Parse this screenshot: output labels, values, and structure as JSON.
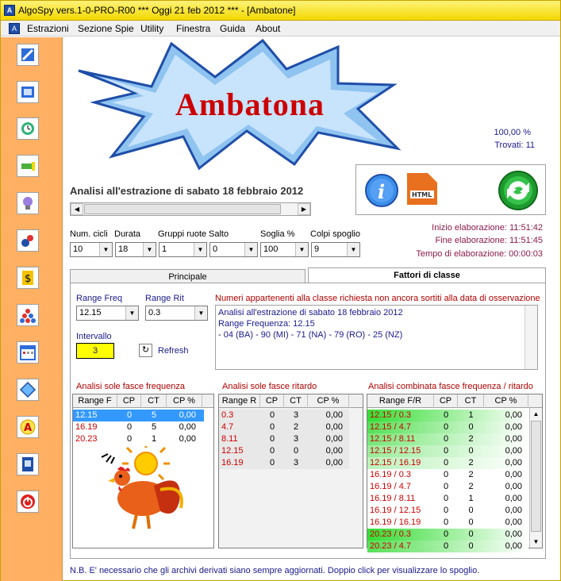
{
  "window": {
    "title": "AlgoSpy vers.1-0-PRO-R00  ***  Oggi 21 feb 2012  ***  - [Ambatone]"
  },
  "menu": [
    "Estrazioni",
    "Sezione Spie",
    "Utility",
    "Finestra",
    "Guida",
    "About"
  ],
  "toolbar_icons": [
    "pencil-icon",
    "book-icon",
    "clock-icon",
    "flashlight-icon",
    "lightbulb-icon",
    "lottery-balls-icon",
    "dollar-icon",
    "pyramid-icon",
    "calendar-icon",
    "diamond-icon",
    "letter-a-icon",
    "notebook-icon",
    "power-icon"
  ],
  "banner": {
    "text": "Ambatona"
  },
  "stats": {
    "percent": "100,00 %",
    "found": "Trovati: 11"
  },
  "analysis_title": "Analisi all'estrazione di sabato 18 febbraio 2012",
  "times": {
    "start": "Inizio elaborazione: 11:51:42",
    "end": "Fine elaborazione: 11:51:45",
    "elapsed": "Tempo di elaborazione: 00:00:03"
  },
  "params": [
    {
      "label": "Num. cicli",
      "value": "10"
    },
    {
      "label": "Durata",
      "value": "18"
    },
    {
      "label": "Gruppi ruote",
      "value": "1"
    },
    {
      "label": "Salto",
      "value": "0"
    },
    {
      "label": "Soglia %",
      "value": "100"
    },
    {
      "label": "Colpi spoglio",
      "value": "9"
    }
  ],
  "tabs": {
    "principale": "Principale",
    "fattori": "Fattori di classe"
  },
  "range_freq": {
    "label": "Range Freq",
    "value": "12.15"
  },
  "range_rit": {
    "label": "Range Rit",
    "value": "0.3"
  },
  "intervallo": {
    "label": "Intervallo",
    "value": "3"
  },
  "refresh_label": "Refresh",
  "numbers_heading": "Numeri appartenenti alla classe richiesta non ancora sortiti alla data di osservazione",
  "numbers_lines": [
    "Analisi all'estrazione di sabato 18 febbraio 2012",
    "Range Frequenza: 12.15",
    " - 04 (BA) - 90 (MI) - 71 (NA) - 79 (RO) - 25 (NZ)"
  ],
  "freq_table": {
    "caption": "Analisi sole fasce frequenza",
    "headers": [
      "Range F",
      "CP",
      "CT",
      "CP %"
    ],
    "rows": [
      [
        "12.15",
        "0",
        "5",
        "0,00"
      ],
      [
        "16.19",
        "0",
        "5",
        "0,00"
      ],
      [
        "20.23",
        "0",
        "1",
        "0,00"
      ]
    ]
  },
  "rit_table": {
    "caption": "Analisi sole fasce ritardo",
    "headers": [
      "Range R",
      "CP",
      "CT",
      "CP %"
    ],
    "rows": [
      [
        "0.3",
        "0",
        "3",
        "0,00"
      ],
      [
        "4.7",
        "0",
        "2",
        "0,00"
      ],
      [
        "8.11",
        "0",
        "3",
        "0,00"
      ],
      [
        "12.15",
        "0",
        "0",
        "0,00"
      ],
      [
        "16.19",
        "0",
        "3",
        "0,00"
      ]
    ]
  },
  "combo_table": {
    "caption": "Analisi combinata fasce frequenza / ritardo",
    "headers": [
      "Range F/R",
      "CP",
      "CT",
      "CP %"
    ],
    "rows": [
      [
        "12.15 / 0.3",
        "0",
        "1",
        "0,00"
      ],
      [
        "12.15 / 4.7",
        "0",
        "0",
        "0,00"
      ],
      [
        "12.15 / 8.11",
        "0",
        "2",
        "0,00"
      ],
      [
        "12.15 / 12.15",
        "0",
        "0",
        "0,00"
      ],
      [
        "12.15 / 16.19",
        "0",
        "2",
        "0,00"
      ],
      [
        "16.19 / 0.3",
        "0",
        "2",
        "0,00"
      ],
      [
        "16.19 / 4.7",
        "0",
        "2",
        "0,00"
      ],
      [
        "16.19 / 8.11",
        "0",
        "1",
        "0,00"
      ],
      [
        "16.19 / 12.15",
        "0",
        "0",
        "0,00"
      ],
      [
        "16.19 / 16.19",
        "0",
        "0",
        "0,00"
      ],
      [
        "20.23 / 0.3",
        "0",
        "0",
        "0,00"
      ],
      [
        "20.23 / 4.7",
        "0",
        "0",
        "0,00"
      ]
    ]
  },
  "note": "N.B. E' necessario che gli archivi derivati siano sempre aggiornati. Doppio click per visualizzare lo spoglio.",
  "colors": {
    "accent_orange": "#ffb063",
    "title_yellow": "#f2d800",
    "banner_red": "#cc0000",
    "green_row": "#33dd33",
    "select_blue": "#3399ff"
  }
}
